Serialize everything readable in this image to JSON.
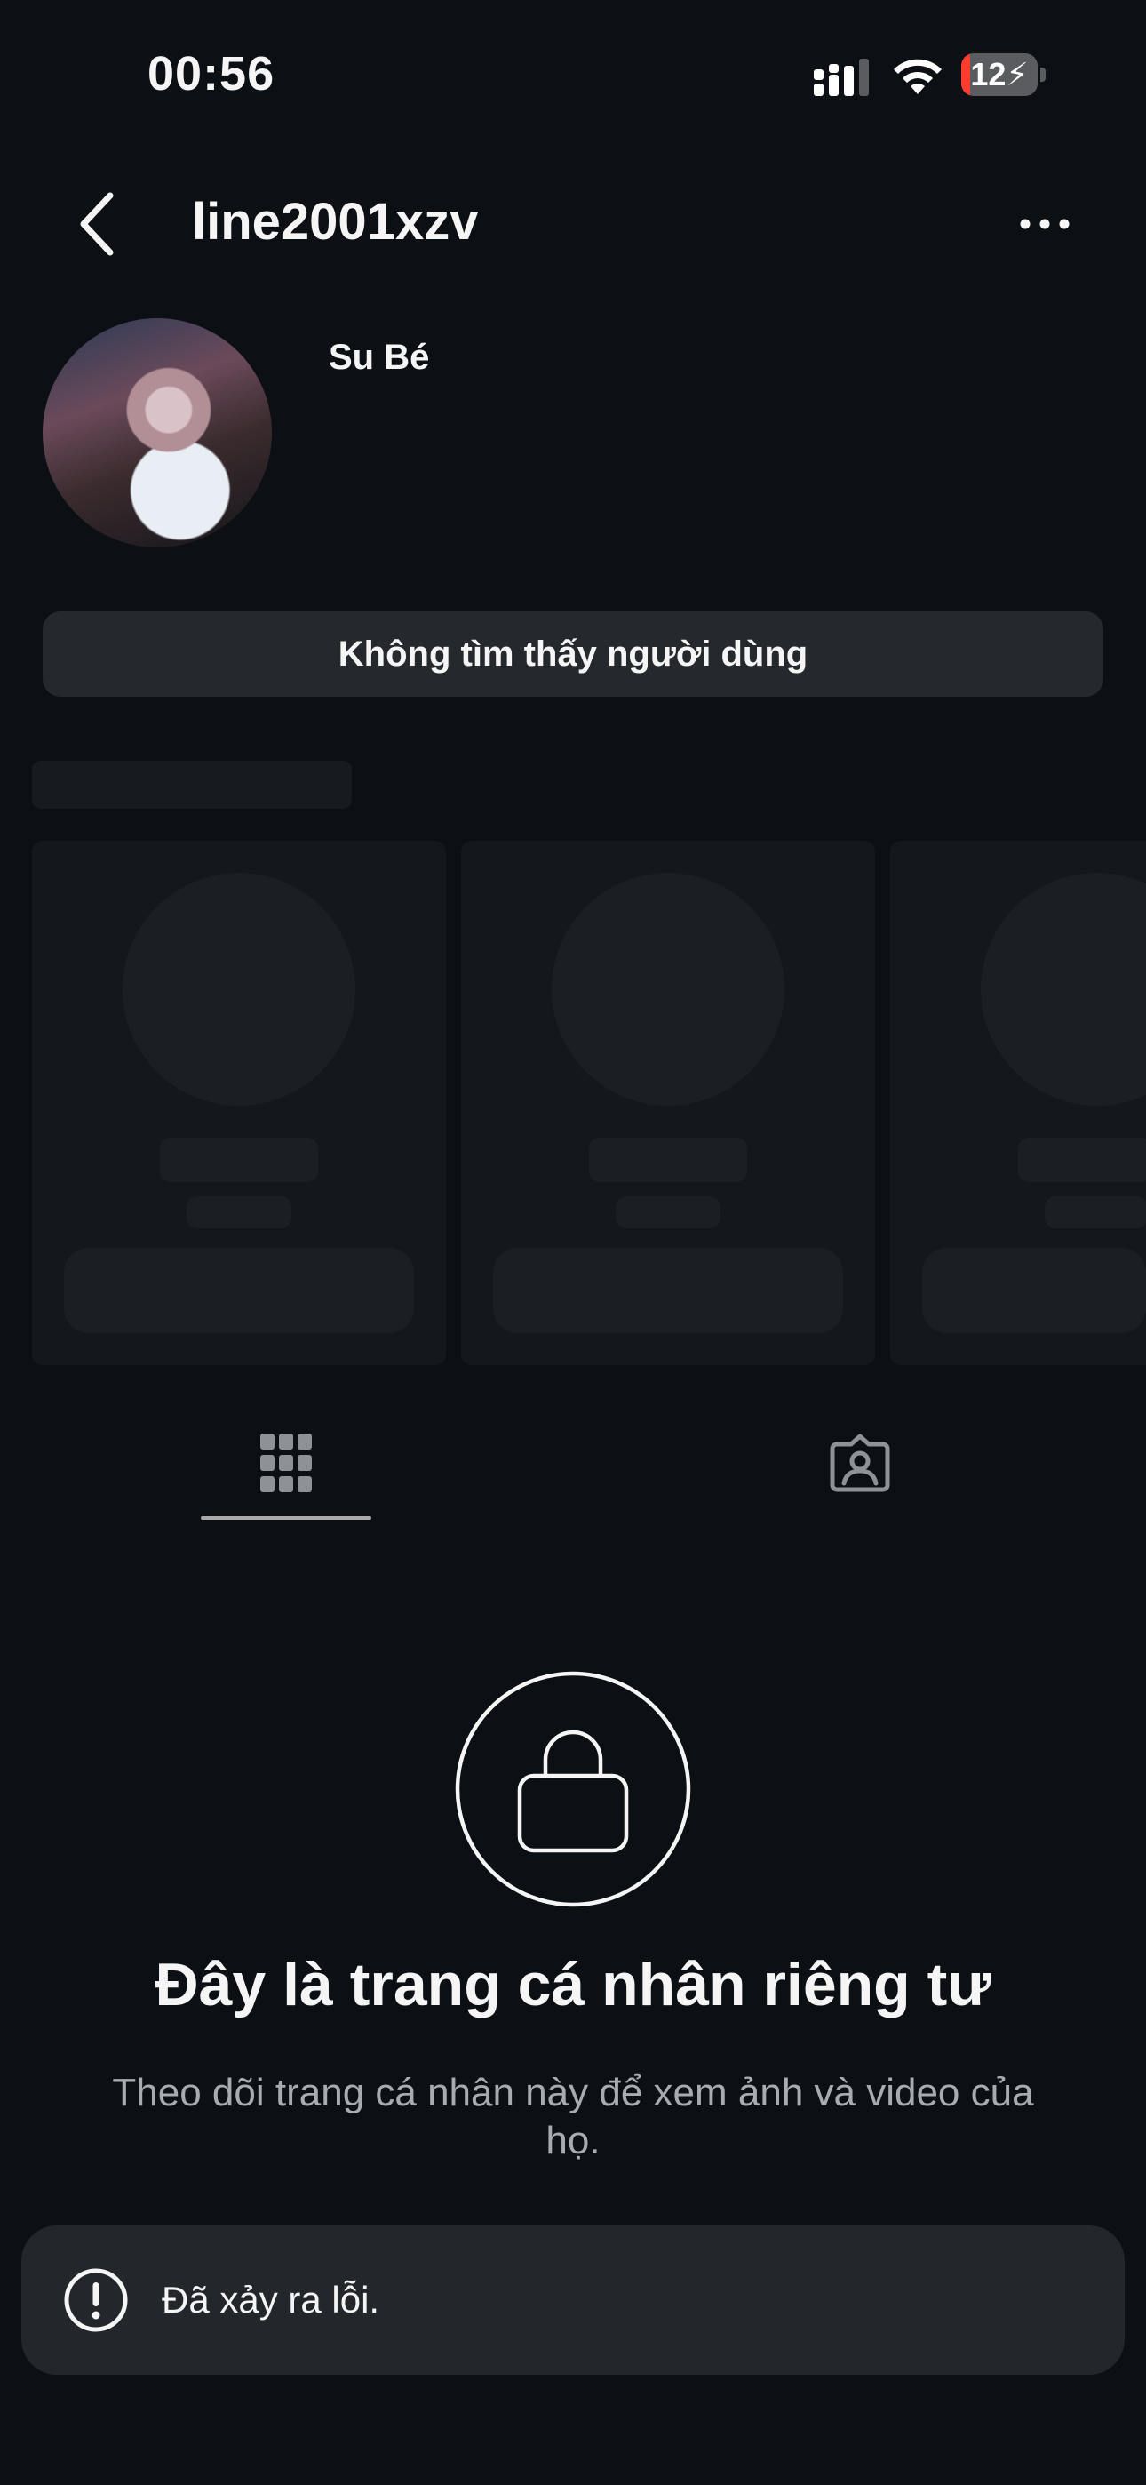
{
  "status_bar": {
    "time": "00:56",
    "battery_level": "12",
    "battery_fraction": 0.12
  },
  "header": {
    "username": "line2001xzv",
    "back_icon": "chevron-left-icon",
    "more_icon": "more-horizontal-icon"
  },
  "profile": {
    "display_name": "Su Bé",
    "avatar": "profile-photo"
  },
  "not_found_button": {
    "label": "Không tìm thấy người dùng"
  },
  "tabs": [
    {
      "icon": "grid-icon",
      "selected": true
    },
    {
      "icon": "tagged-user-icon",
      "selected": false
    }
  ],
  "private_notice": {
    "icon": "lock-icon",
    "title": "Đây là trang cá nhân riêng tư",
    "subtitle": "Theo dõi trang cá nhân này để xem ảnh và video của họ."
  },
  "toast": {
    "icon": "alert-circle-icon",
    "message": "Đã xảy ra lỗi."
  },
  "colors": {
    "background": "#0c1014",
    "button_bg": "#25292e",
    "toast_bg": "#23272b",
    "battery_low": "#ff3b30"
  }
}
